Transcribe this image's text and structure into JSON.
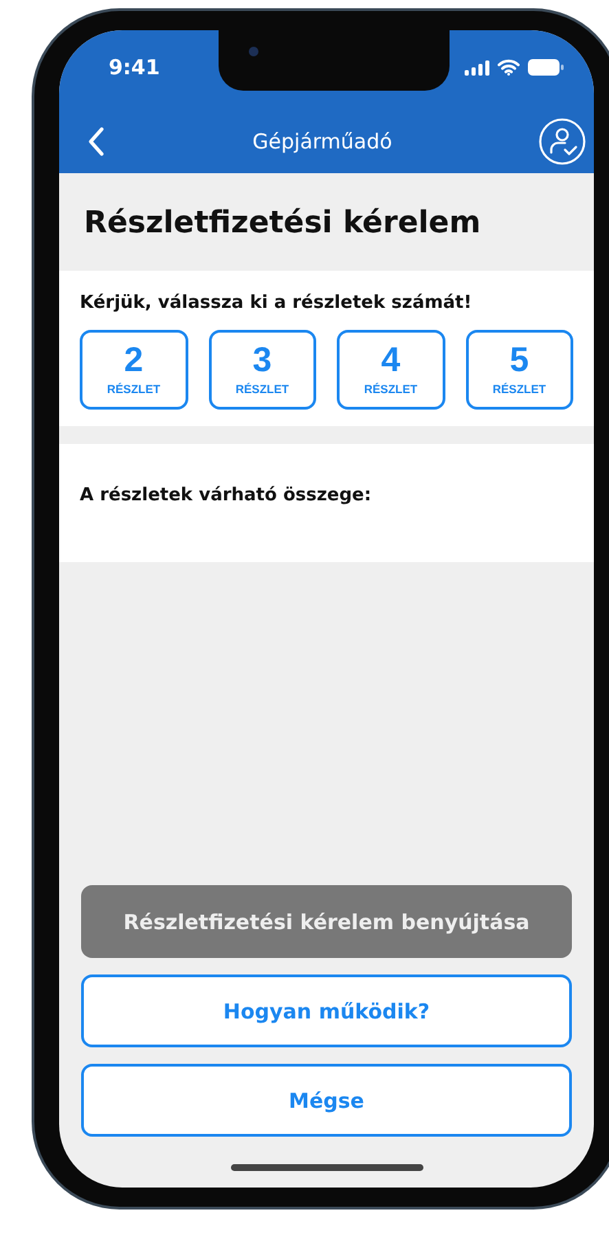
{
  "status_bar": {
    "time": "9:41"
  },
  "nav": {
    "title": "Gépjárműadó"
  },
  "heading": "Részletfizetési kérelem",
  "installments": {
    "prompt": "Kérjük, válassza ki a részletek számát!",
    "options": [
      {
        "number": "2",
        "unit": "RÉSZLET",
        "selected": false
      },
      {
        "number": "3",
        "unit": "RÉSZLET",
        "selected": false
      },
      {
        "number": "4",
        "unit": "RÉSZLET",
        "selected": false
      },
      {
        "number": "5",
        "unit": "RÉSZLET",
        "selected": false
      }
    ]
  },
  "amount": {
    "label": "A részletek várható összege:"
  },
  "buttons": [
    {
      "label": "Részletfizetési kérelem benyújtása",
      "kind": "primary",
      "disabled": true
    },
    {
      "label": "Hogyan működik?",
      "kind": "outline",
      "disabled": false
    },
    {
      "label": "Mégse",
      "kind": "outline",
      "disabled": false
    }
  ]
}
